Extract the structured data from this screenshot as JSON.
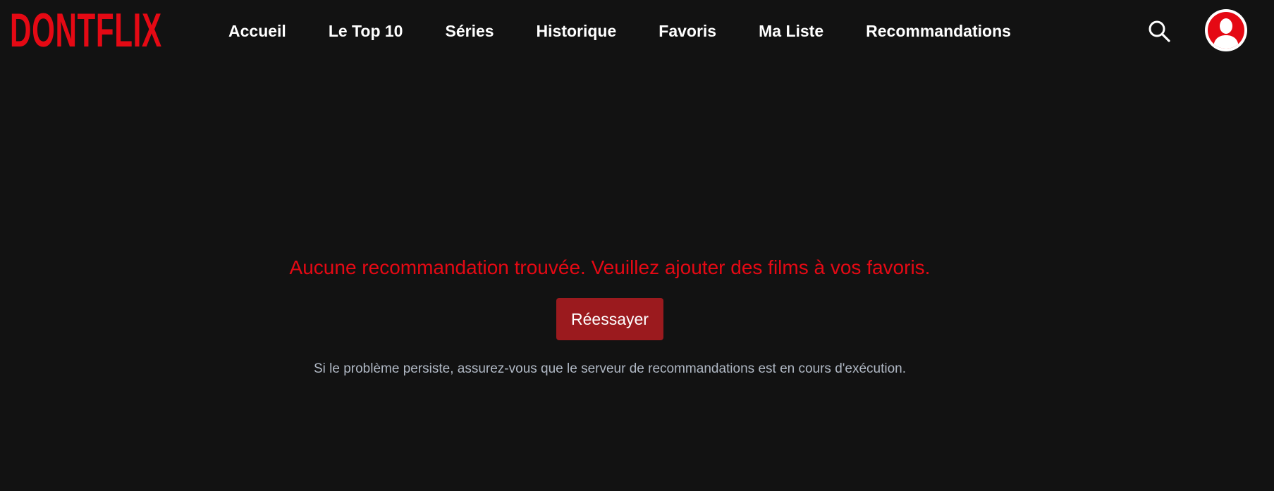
{
  "app": {
    "logo_text": "DONTFLIX"
  },
  "nav": {
    "items": [
      {
        "label": "Accueil"
      },
      {
        "label": "Le Top 10"
      },
      {
        "label": "Séries"
      },
      {
        "label": "Historique"
      },
      {
        "label": "Favoris"
      },
      {
        "label": "Ma Liste"
      },
      {
        "label": "Recommandations"
      }
    ]
  },
  "header_icons": {
    "search": "search-icon",
    "profile": "user-avatar-icon"
  },
  "content": {
    "message": "Aucune recommandation trouvée. Veuillez ajouter des films à vos favoris.",
    "retry_label": "Réessayer",
    "hint": "Si le problème persiste, assurez-vous que le serveur de recommandations est en cours d'exécution."
  },
  "colors": {
    "background": "#121212",
    "brand_red": "#e50914",
    "button_red": "#9b1a1e",
    "hint_text": "#b0b8c4",
    "nav_text": "#ffffff"
  }
}
